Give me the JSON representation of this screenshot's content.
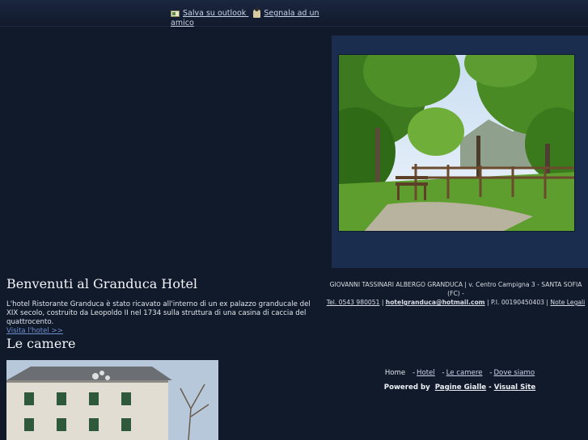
{
  "topbar": {
    "outlook_label": "Salva su outlook",
    "friend_label": "Segnala ad un amico"
  },
  "welcome": {
    "title": "Benvenuti al Granduca Hotel",
    "text": "L'hotel Ristorante Granduca è stato ricavato all'interno di un ex palazzo granducale del XIX secolo, costruito da Leopoldo II nel 1734 sulla struttura di una casina di caccia del quattrocento.",
    "link": "Visita l'hotel >>"
  },
  "rooms": {
    "title": "Le camere"
  },
  "company": {
    "line1": "GIOVANNI TASSINARI ALBERGO GRANDUCA | v. Centro Campigna 3 - SANTA SOFIA (FC) -",
    "phone": "Tel. 0543 980051",
    "email": "hotelgranduca@hotmail.com",
    "vat": "| P.I. 00190450403 |",
    "legal": "Note Legali"
  },
  "nav": {
    "home": "Home",
    "hotel": "Hotel",
    "rooms": "Le camere",
    "where": "Dove siamo",
    "sep": "-"
  },
  "powered": {
    "label": "Powered by",
    "pagine": "Pagine Gialle",
    "dash": "-",
    "visual": "Visual Site"
  }
}
